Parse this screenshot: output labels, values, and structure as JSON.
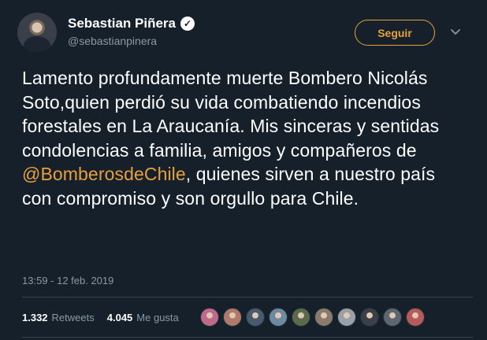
{
  "author": {
    "name": "Sebastian Piñera",
    "handle": "@sebastianpinera",
    "verified_icon": "verified-badge-icon"
  },
  "follow_button": {
    "label": "Seguir"
  },
  "menu_icon": "chevron-down-icon",
  "tweet": {
    "text_before_mention": "Lamento profundamente muerte Bombero Nicolás Soto,quien perdió su vida combatiendo incendios forestales en La Araucanía. Mis sinceras y sentidas condolencias a familia, amigos y compañeros de ",
    "mention": "@BomberosdeChile",
    "text_after_mention": ", quienes sirven a nuestro país con compromiso y son orgullo para Chile.",
    "timestamp": "13:59 - 12 feb. 2019"
  },
  "stats": {
    "retweets_count": "1.332",
    "retweets_label": "Retweets",
    "likes_count": "4.045",
    "likes_label": "Me gusta"
  },
  "likers_avatars": [
    {
      "color": "#c06a8a"
    },
    {
      "color": "#b07a6a"
    },
    {
      "color": "#4a5a6e"
    },
    {
      "color": "#6e8a9e"
    },
    {
      "color": "#5a6a4a"
    },
    {
      "color": "#8a7a6a"
    },
    {
      "color": "#9aa0a8"
    },
    {
      "color": "#3a3f48"
    },
    {
      "color": "#5e6670"
    },
    {
      "color": "#b85a5a"
    }
  ],
  "colors": {
    "background": "#15202b",
    "accent": "#e8a03d",
    "secondary_text": "#8899a6",
    "divider": "#38444d"
  }
}
